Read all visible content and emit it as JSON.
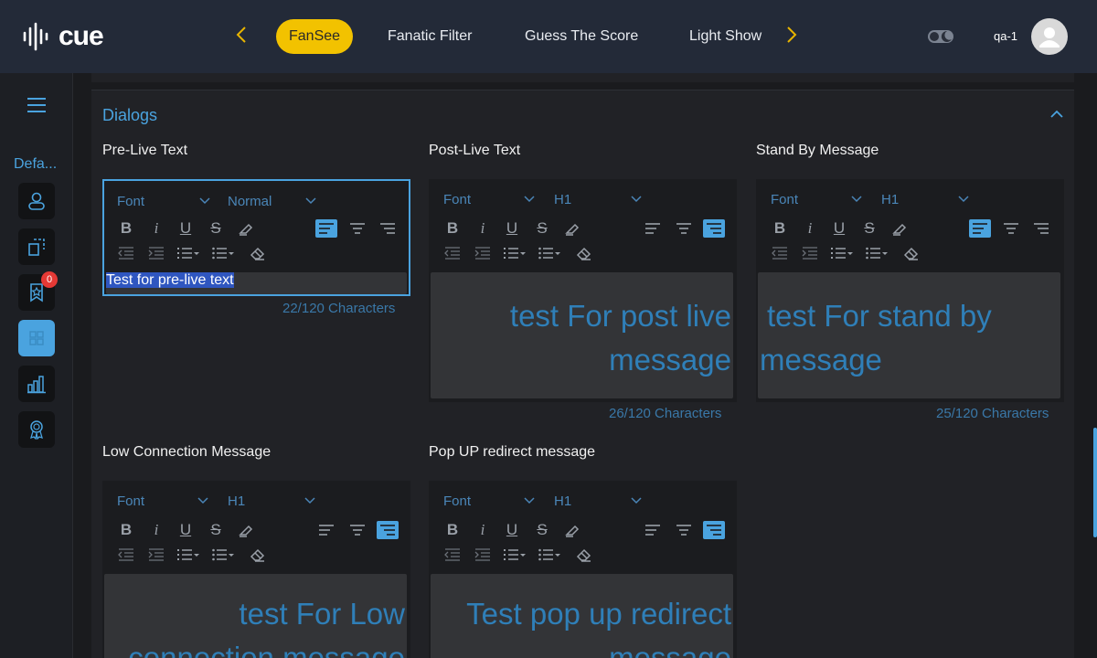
{
  "app": {
    "logo_text": "cue"
  },
  "nav": {
    "tabs": [
      {
        "label": "FanSee",
        "active": true
      },
      {
        "label": "Fanatic Filter"
      },
      {
        "label": "Guess The Score"
      },
      {
        "label": "Light Show"
      }
    ]
  },
  "user": {
    "name": "qa-1"
  },
  "sidebar": {
    "label": "Defa...",
    "badge_count": "0",
    "items": [
      "user-icon",
      "frame-icon",
      "ribbon-icon",
      "grid-icon",
      "chart-icon",
      "award-icon"
    ]
  },
  "panel": {
    "title": "Dialogs"
  },
  "editors": [
    {
      "label": "Pre-Live Text",
      "font": "Font",
      "size": "Normal",
      "content": "Test for pre-live text",
      "count": "22/120 Characters"
    },
    {
      "label": "Post-Live Text",
      "font": "Font",
      "size": "H1",
      "content_line1": "test For post live",
      "content_line2": "message",
      "count": "26/120 Characters"
    },
    {
      "label": "Stand By Message",
      "font": "Font",
      "size": "H1",
      "content_line1": "test For stand by",
      "content_line2": "message",
      "count": "25/120 Characters"
    },
    {
      "label": "Low Connection Message",
      "font": "Font",
      "size": "H1",
      "content_line1": "test For Low",
      "content_line2": "connection message"
    },
    {
      "label": "Pop UP redirect message",
      "font": "Font",
      "size": "H1",
      "content_line1": "Test pop up redirect",
      "content_line2": "message"
    }
  ],
  "colors": {
    "accent": "#4aa3df",
    "brand_yellow": "#f2c200",
    "header_bg": "#232a38"
  }
}
